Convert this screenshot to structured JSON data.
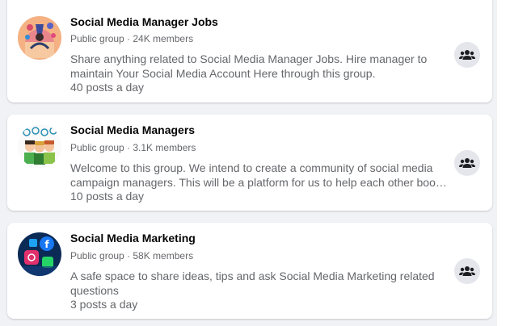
{
  "groups": [
    {
      "name": "Social Media Manager Jobs",
      "meta": "Public group · 24K members",
      "description_lines": [
        "Share anything related to Social Media Manager Jobs. Hire manager to",
        "maintain Your Social Media Account Here through this group."
      ],
      "activity": "40 posts a day",
      "avatar_icon": "social-media-illustration"
    },
    {
      "name": "Social Media Managers",
      "meta": "Public group · 3.1K members",
      "description_lines": [
        "Welcome to this group. We intend to create a community of social media",
        "campaign managers. This will be a platform for us to help each other boostin..."
      ],
      "activity": "10 posts a day",
      "avatar_icon": "team-cartoon-illustration"
    },
    {
      "name": "Social Media Marketing",
      "meta": "Public group · 58K members",
      "description_lines": [
        "A safe space to share ideas, tips and ask Social Media Marketing related",
        "questions"
      ],
      "activity": "3 posts a day",
      "avatar_icon": "social-app-icons-photo"
    }
  ],
  "join_icon": "group-icon",
  "colors": {
    "background": "#f0f2f5",
    "card": "#ffffff",
    "title": "#050505",
    "secondary_text": "#65676b",
    "button_bg": "#e4e6eb"
  }
}
